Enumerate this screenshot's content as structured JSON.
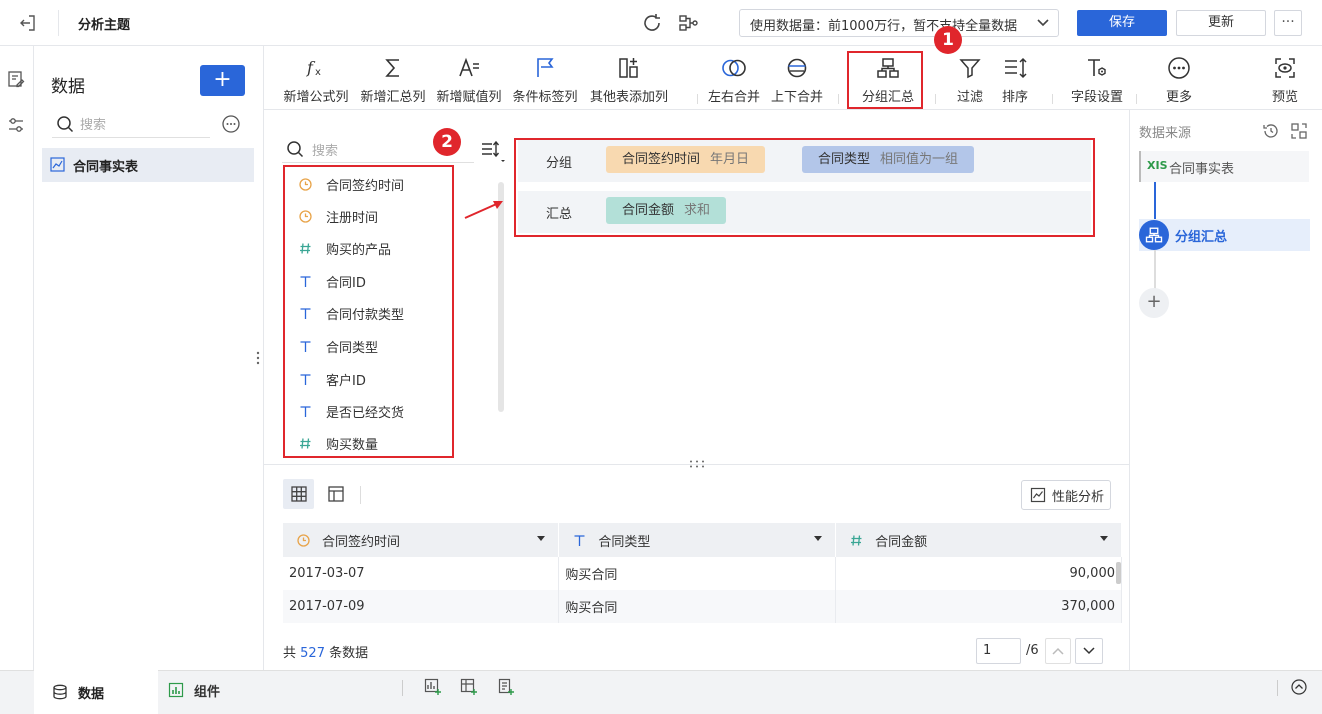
{
  "header": {
    "title": "分析主题",
    "data_limit_select": "使用数据量：前1000万行，暂不支持全量数据",
    "save_label": "保存",
    "update_label": "更新",
    "more_label": "···"
  },
  "data_panel": {
    "title": "数据",
    "add_label": "+",
    "search_placeholder": "搜索",
    "tables": [
      {
        "label": "合同事实表"
      }
    ]
  },
  "toolbar": {
    "items": [
      {
        "label": "新增公式列",
        "icon": "formula-icon"
      },
      {
        "label": "新增汇总列",
        "icon": "sum-icon"
      },
      {
        "label": "新增赋值列",
        "icon": "assign-icon"
      },
      {
        "label": "条件标签列",
        "icon": "flag-icon"
      },
      {
        "label": "其他表添加列",
        "icon": "add-column-icon"
      },
      {
        "label": "左右合并",
        "icon": "merge-horizontal-icon"
      },
      {
        "label": "上下合并",
        "icon": "merge-vertical-icon"
      },
      {
        "label": "分组汇总",
        "icon": "group-summary-icon"
      },
      {
        "label": "过滤",
        "icon": "filter-icon"
      },
      {
        "label": "排序",
        "icon": "sort-icon"
      },
      {
        "label": "字段设置",
        "icon": "field-settings-icon"
      },
      {
        "label": "更多",
        "icon": "more-circle-icon"
      },
      {
        "label": "预览",
        "icon": "preview-icon"
      }
    ]
  },
  "annotations": {
    "badge1": "1",
    "badge2": "2"
  },
  "field_list": {
    "search_placeholder": "搜索",
    "fields": [
      {
        "label": "合同签约时间",
        "type": "date"
      },
      {
        "label": "注册时间",
        "type": "date"
      },
      {
        "label": "购买的产品",
        "type": "number"
      },
      {
        "label": "合同ID",
        "type": "text"
      },
      {
        "label": "合同付款类型",
        "type": "text"
      },
      {
        "label": "合同类型",
        "type": "text"
      },
      {
        "label": "客户ID",
        "type": "text"
      },
      {
        "label": "是否已经交货",
        "type": "text"
      },
      {
        "label": "购买数量",
        "type": "number"
      }
    ]
  },
  "config": {
    "group_label": "分组",
    "summary_label": "汇总",
    "group_fields": [
      {
        "name": "合同签约时间",
        "mode": "年月日",
        "color": "#f8d9b0"
      },
      {
        "name": "合同类型",
        "mode": "相同值为一组",
        "color": "#b3c6e9"
      }
    ],
    "summary_fields": [
      {
        "name": "合同金额",
        "mode": "求和",
        "color": "#b3e0d8"
      }
    ]
  },
  "right_panel": {
    "title": "数据来源",
    "source": "合同事实表",
    "source_icon_text": "XⅠS",
    "step": "分组汇总",
    "add_label": "+"
  },
  "preview": {
    "perf_label": "性能分析",
    "columns": [
      {
        "label": "合同签约时间",
        "type": "date"
      },
      {
        "label": "合同类型",
        "type": "text"
      },
      {
        "label": "合同金额",
        "type": "number"
      }
    ],
    "rows": [
      [
        "2017-03-07",
        "购买合同",
        "90,000"
      ],
      [
        "2017-07-09",
        "购买合同",
        "370,000"
      ]
    ],
    "count_prefix": "共",
    "count_value": "527",
    "count_suffix": "条数据",
    "page_current": "1",
    "page_total": "/6"
  },
  "bottom": {
    "tab_data": "数据",
    "tab_component": "组件"
  },
  "colors": {
    "accent": "#2a66d9",
    "highlight": "#e0262c"
  }
}
